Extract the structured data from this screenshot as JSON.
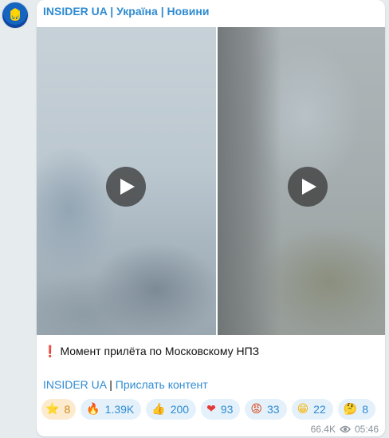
{
  "channel": {
    "name": "INSIDER UA",
    "sep1": "|",
    "country": "Україна",
    "sep2": "|",
    "section": "Новини",
    "avatar_icon": "trident-emblem-icon"
  },
  "media": {
    "videos": [
      {
        "play_icon": "play-icon"
      },
      {
        "play_icon": "play-icon"
      }
    ]
  },
  "message": {
    "mark": "❗",
    "text": "Момент прилёта по Московскому НПЗ"
  },
  "footer_links": {
    "channel": "INSIDER UA",
    "sep": "|",
    "submit": "Прислать контент"
  },
  "reactions": [
    {
      "emoji": "⭐",
      "count": "8",
      "icon": "star-icon"
    },
    {
      "emoji": "🔥",
      "count": "1.39K",
      "icon": "fire-icon"
    },
    {
      "emoji": "👍",
      "count": "200",
      "icon": "thumbs-up-icon"
    },
    {
      "emoji": "❤",
      "count": "93",
      "icon": "heart-icon"
    },
    {
      "emoji": "😡",
      "count": "33",
      "icon": "angry-face-icon"
    },
    {
      "emoji": "😁",
      "count": "22",
      "icon": "grin-face-icon"
    },
    {
      "emoji": "🤔",
      "count": "8",
      "icon": "thinking-face-icon"
    }
  ],
  "meta": {
    "views": "66.4K",
    "time": "05:46",
    "views_icon": "eye-icon"
  },
  "colors": {
    "accent": "#2f8bd1",
    "bubble": "#ffffff",
    "background": "#e6ebee",
    "reaction_bg": "#e4f1fb",
    "paid_reaction_bg": "#fdebcf"
  }
}
